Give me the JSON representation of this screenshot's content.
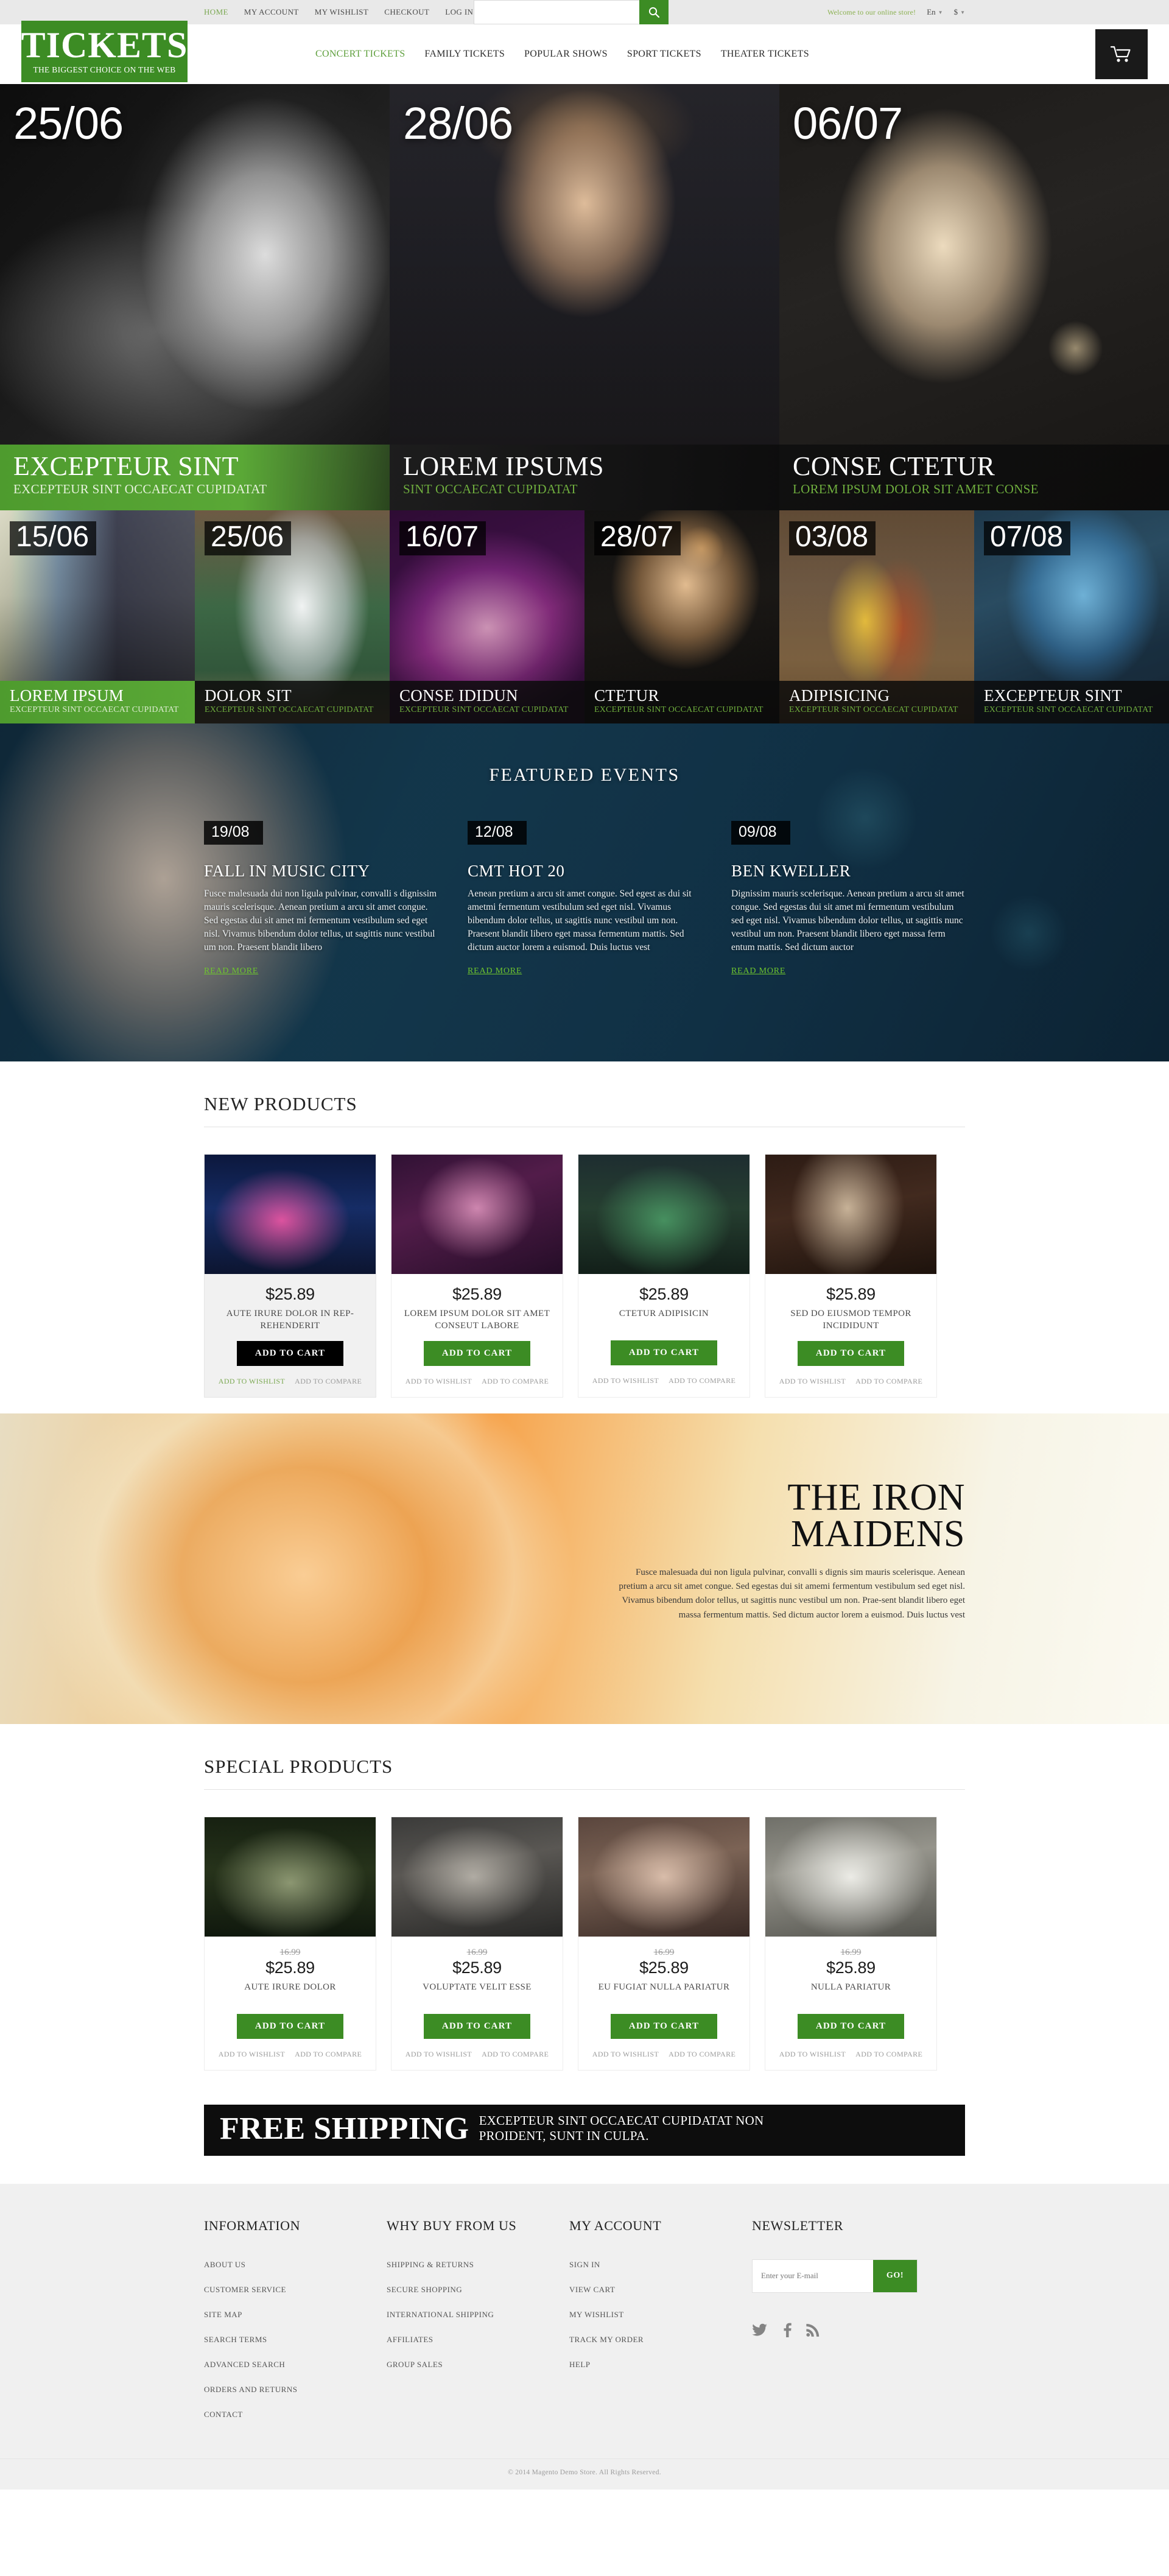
{
  "topbar": {
    "links": [
      {
        "label": "HOME",
        "active": true
      },
      {
        "label": "MY ACCOUNT",
        "active": false
      },
      {
        "label": "MY WISHLIST",
        "active": false
      },
      {
        "label": "CHECKOUT",
        "active": false
      },
      {
        "label": "LOG IN",
        "active": false
      }
    ],
    "welcome": "Welcome to our online store!",
    "language": "En",
    "currency": "$",
    "search_placeholder": ""
  },
  "header": {
    "logo_title": "TICKETS",
    "logo_sub": "THE BIGGEST CHOICE ON THE WEB",
    "nav": [
      {
        "label": "CONCERT TICKETS",
        "active": true
      },
      {
        "label": "FAMILY TICKETS",
        "active": false
      },
      {
        "label": "POPULAR SHOWS",
        "active": false
      },
      {
        "label": "SPORT TICKETS",
        "active": false
      },
      {
        "label": "THEATER TICKETS",
        "active": false
      }
    ]
  },
  "hero": [
    {
      "date": "25/06",
      "title": "EXCEPTEUR SINT",
      "subtitle": "EXCEPTEUR SINT OCCAECAT CUPIDATAT"
    },
    {
      "date": "28/06",
      "title": "LOREM IPSUMS",
      "subtitle": "SINT OCCAECAT CUPIDATAT"
    },
    {
      "date": "06/07",
      "title": "CONSE CTETUR",
      "subtitle": "LOREM IPSUM DOLOR SIT AMET CONSE"
    }
  ],
  "strip": [
    {
      "date": "15/06",
      "title": "LOREM IPSUM",
      "subtitle": "EXCEPTEUR SINT OCCAECAT CUPIDATAT"
    },
    {
      "date": "25/06",
      "title": "DOLOR SIT",
      "subtitle": "EXCEPTEUR SINT OCCAECAT CUPIDATAT"
    },
    {
      "date": "16/07",
      "title": "CONSE IDIDUN",
      "subtitle": "EXCEPTEUR SINT OCCAECAT CUPIDATAT"
    },
    {
      "date": "28/07",
      "title": "CTETUR",
      "subtitle": "EXCEPTEUR SINT OCCAECAT CUPIDATAT"
    },
    {
      "date": "03/08",
      "title": "ADIPISICING",
      "subtitle": "EXCEPTEUR SINT OCCAECAT CUPIDATAT"
    },
    {
      "date": "07/08",
      "title": "EXCEPTEUR SINT",
      "subtitle": "EXCEPTEUR SINT OCCAECAT CUPIDATAT"
    }
  ],
  "featured": {
    "title": "FEATURED EVENTS",
    "read_more": "READ MORE",
    "items": [
      {
        "date": "19/08",
        "title": "FALL IN MUSIC CITY",
        "text": "Fusce malesuada dui non ligula pulvinar, convalli s dignissim mauris scelerisque. Aenean pretium a arcu sit amet congue. Sed egestas dui sit amet mi fermentum vestibulum sed eget nisl. Vivamus bibendum dolor tellus, ut sagittis nunc vestibul um non. Praesent blandit libero"
      },
      {
        "date": "12/08",
        "title": "CMT HOT 20",
        "text": "Aenean pretium a arcu sit amet congue. Sed egest as dui sit ametmi fermentum vestibulum sed eget nisl. Vivamus bibendum dolor tellus, ut sagittis nunc vestibul um non. Praesent blandit libero eget massa fermentum mattis. Sed dictum auctor lorem a euismod. Duis luctus vest"
      },
      {
        "date": "09/08",
        "title": "BEN KWELLER",
        "text": "Dignissim mauris scelerisque. Aenean pretium a arcu sit amet congue. Sed egestas dui sit amet mi fermentum vestibulum sed eget nisl. Vivamus bibendum dolor tellus, ut sagittis nunc vestibul um non. Praesent blandit libero eget massa ferm entum mattis. Sed dictum auctor"
      }
    ]
  },
  "new_products": {
    "heading": "NEW PRODUCTS",
    "add_to_cart": "ADD TO CART",
    "add_to_wishlist": "ADD TO WISHLIST",
    "add_to_compare": "ADD TO COMPARE",
    "items": [
      {
        "price": "$25.89",
        "old_price": "",
        "name": "AUTE IRURE DOLOR IN REP-REHENDERIT",
        "highlighted": true
      },
      {
        "price": "$25.89",
        "old_price": "",
        "name": "LOREM IPSUM DOLOR SIT AMET CONSEUT LABORE",
        "highlighted": false
      },
      {
        "price": "$25.89",
        "old_price": "",
        "name": "CTETUR ADIPISICIN",
        "highlighted": false
      },
      {
        "price": "$25.89",
        "old_price": "",
        "name": "SED DO EIUSMOD TEMPOR INCIDIDUNT",
        "highlighted": false
      }
    ]
  },
  "iron_banner": {
    "title_line1": "THE IRON",
    "title_line2": "MAIDENS",
    "text": "Fusce malesuada dui non ligula pulvinar, convalli s dignis sim mauris scelerisque. Aenean pretium a arcu sit amet congue. Sed egestas dui sit amemi fermentum vestibulum sed eget nisl. Vivamus bibendum dolor tellus, ut sagittis nunc vestibul um non. Prae-sent blandit libero eget massa fermentum mattis. Sed dictum auctor lorem a euismod. Duis luctus vest"
  },
  "special_products": {
    "heading": "SPECIAL PRODUCTS",
    "add_to_cart": "ADD TO CART",
    "add_to_wishlist": "ADD TO WISHLIST",
    "add_to_compare": "ADD TO COMPARE",
    "items": [
      {
        "price": "$25.89",
        "old_price": "16.99",
        "name": "AUTE IRURE DOLOR"
      },
      {
        "price": "$25.89",
        "old_price": "16.99",
        "name": "VOLUPTATE VELIT ESSE"
      },
      {
        "price": "$25.89",
        "old_price": "16.99",
        "name": "EU FUGIAT NULLA PARIATUR"
      },
      {
        "price": "$25.89",
        "old_price": "16.99",
        "name": "NULLA PARIATUR"
      }
    ]
  },
  "shipping_banner": {
    "big": "FREE SHIPPING",
    "small_line1": "EXCEPTEUR SINT OCCAECAT CUPIDATAT NON",
    "small_line2": "PROIDENT, SUNT IN CULPA."
  },
  "footer": {
    "columns": [
      {
        "title": "INFORMATION",
        "links": [
          "ABOUT US",
          "CUSTOMER SERVICE",
          "SITE MAP",
          "SEARCH TERMS",
          "ADVANCED SEARCH",
          "ORDERS AND RETURNS",
          "CONTACT"
        ]
      },
      {
        "title": "WHY BUY FROM US",
        "links": [
          "SHIPPING & RETURNS",
          "SECURE SHOPPING",
          "INTERNATIONAL SHIPPING",
          "AFFILIATES",
          "GROUP SALES"
        ]
      },
      {
        "title": "MY ACCOUNT",
        "links": [
          "SIGN IN",
          "VIEW CART",
          "MY WISHLIST",
          "TRACK MY ORDER",
          "HELP"
        ]
      }
    ],
    "newsletter": {
      "title": "NEWSLETTER",
      "placeholder": "Enter your E-mail",
      "button": "GO!"
    },
    "socials": [
      "twitter-icon",
      "facebook-icon",
      "rss-icon"
    ],
    "copyright": "© 2014 Magento Demo Store. All Rights Reserved."
  },
  "colors": {
    "brand_green": "#3c8c24",
    "accent_green": "#6fae3e",
    "dark": "#0d0d0d"
  }
}
